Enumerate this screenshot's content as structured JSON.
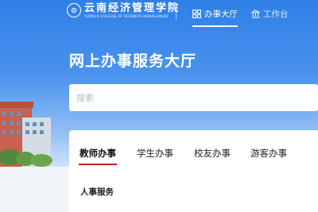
{
  "header": {
    "logo_cn": "云南经济管理学院",
    "logo_en": "YUNNAN COLLEGE OF BUSINESS MANAGEMENT",
    "nav": [
      {
        "label": "办事大厅",
        "icon": "grid-icon",
        "active": true
      },
      {
        "label": "工作台",
        "icon": "building-icon",
        "active": false
      }
    ]
  },
  "hero": {
    "title": "网上办事服务大厅"
  },
  "search": {
    "placeholder": "搜索"
  },
  "tabs": [
    {
      "label": "教师办事",
      "active": true
    },
    {
      "label": "学生办事",
      "active": false
    },
    {
      "label": "校友办事",
      "active": false
    },
    {
      "label": "游客办事",
      "active": false
    }
  ],
  "section": {
    "title": "人事服务"
  },
  "colors": {
    "brand_blue": "#2f7fe6",
    "tab_active_underline": "#c81e1e"
  }
}
